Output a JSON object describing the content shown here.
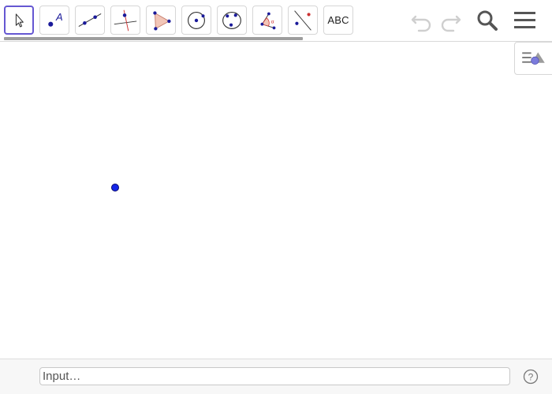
{
  "toolbar": {
    "tools": [
      {
        "name": "move-tool",
        "selected": true
      },
      {
        "name": "point-tool"
      },
      {
        "name": "line-tool"
      },
      {
        "name": "perpendicular-line-tool"
      },
      {
        "name": "polygon-tool"
      },
      {
        "name": "circle-tool"
      },
      {
        "name": "conic-tool"
      },
      {
        "name": "angle-tool"
      },
      {
        "name": "reflect-tool"
      },
      {
        "name": "text-tool",
        "label": "ABC"
      }
    ],
    "point_tool_label": "A"
  },
  "header": {
    "undo_icon": "undo-icon",
    "redo_icon": "redo-icon",
    "search_icon": "search-icon",
    "menu_icon": "hamburger-menu-icon"
  },
  "graphics": {
    "point_color": "#1526e8"
  },
  "algebra_input": {
    "placeholder": "Input…"
  },
  "colors": {
    "selected_border": "#6557d2",
    "tool_blue": "#1a1a9a",
    "tool_red": "#cc3333",
    "polygon_fill": "#f2c6b8"
  }
}
